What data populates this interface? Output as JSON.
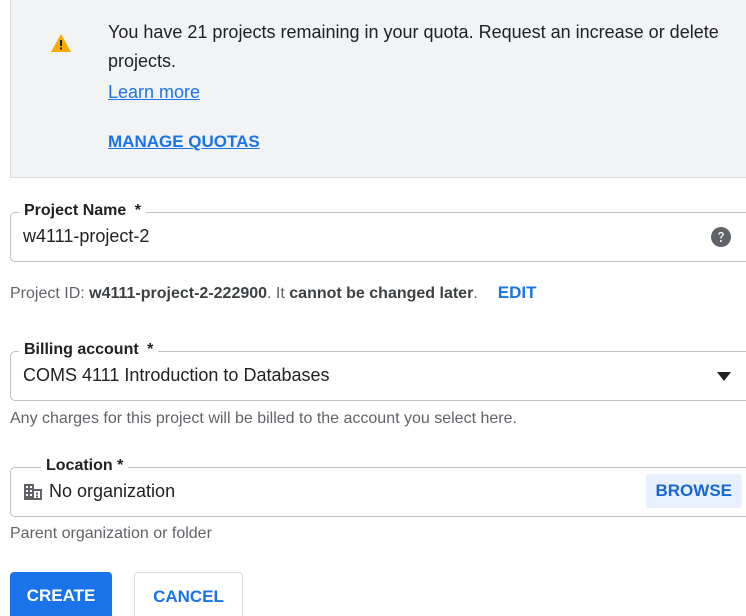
{
  "banner": {
    "message": "You have 21 projects remaining in your quota. Request an increase or delete projects.",
    "learn_more": "Learn more",
    "manage_quotas": "MANAGE QUOTAS",
    "icon": "warning-icon",
    "icon_color": "#f9ab00"
  },
  "project_name": {
    "label": "Project Name",
    "required_mark": "*",
    "value": "w4111-project-2",
    "help_icon": "help-circle-icon"
  },
  "project_id": {
    "prefix": "Project ID: ",
    "id": "w4111-project-2-222900",
    "middle": ". It ",
    "emphasis": "cannot be changed later",
    "suffix": ".",
    "edit_label": "EDIT"
  },
  "billing": {
    "label": "Billing account",
    "required_mark": "*",
    "value": "COMS 4111 Introduction to Databases",
    "hint": "Any charges for this project will be billed to the account you select here.",
    "dropdown_icon": "caret-down-icon"
  },
  "location": {
    "label": "Location *",
    "value": "No organization",
    "browse_label": "BROWSE",
    "hint": "Parent organization or folder",
    "icon": "organization-icon"
  },
  "actions": {
    "create_label": "CREATE",
    "cancel_label": "CANCEL"
  },
  "colors": {
    "primary": "#1a73e8",
    "banner_bg": "#f1f3f4",
    "warning": "#f9ab00"
  }
}
